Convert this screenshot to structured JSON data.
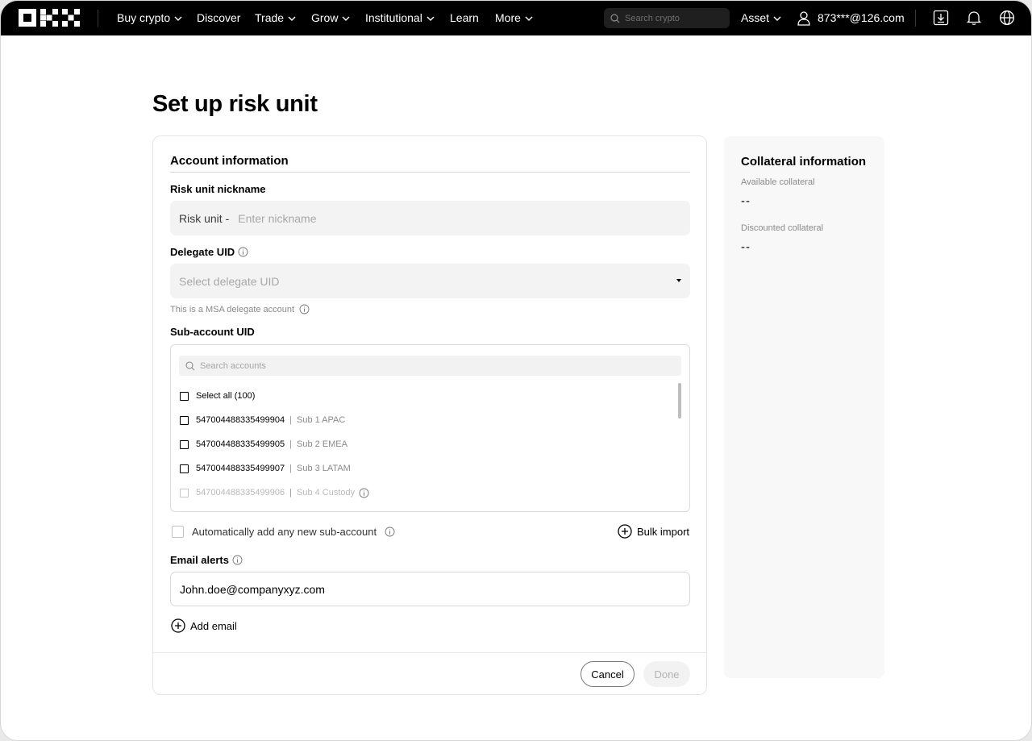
{
  "nav": {
    "items": [
      {
        "label": "Buy crypto",
        "dropdown": true
      },
      {
        "label": "Discover",
        "dropdown": false
      },
      {
        "label": "Trade",
        "dropdown": true
      },
      {
        "label": "Grow",
        "dropdown": true
      },
      {
        "label": "Institutional",
        "dropdown": true
      },
      {
        "label": "Learn",
        "dropdown": false
      },
      {
        "label": "More",
        "dropdown": true
      }
    ],
    "search_placeholder": "Search crypto",
    "asset_label": "Asset",
    "user_email": "873***@126.com",
    "icons": [
      "download-icon",
      "bell-icon",
      "globe-icon"
    ]
  },
  "page": {
    "title": "Set up risk unit"
  },
  "account": {
    "section_title": "Account information",
    "nickname_label": "Risk unit nickname",
    "nickname_prefix": "Risk unit -",
    "nickname_placeholder": "Enter nickname",
    "delegate_label": "Delegate UID",
    "delegate_placeholder": "Select delegate UID",
    "delegate_hint": "This is a MSA delegate account",
    "subaccount_label": "Sub-account UID",
    "search_accounts_placeholder": "Search accounts",
    "select_all_label": "Select all (100)",
    "subaccounts": [
      {
        "uid": "547004488335499904",
        "name": "Sub 1 APAC",
        "disabled": false,
        "info": false
      },
      {
        "uid": "547004488335499905",
        "name": "Sub 2 EMEA",
        "disabled": false,
        "info": false
      },
      {
        "uid": "547004488335499907",
        "name": "Sub 3 LATAM",
        "disabled": false,
        "info": false
      },
      {
        "uid": "547004488335499906",
        "name": "Sub 4 Custody",
        "disabled": true,
        "info": true
      }
    ],
    "auto_add_label": "Automatically add any new sub-account",
    "bulk_import_label": "Bulk import",
    "email_alerts_label": "Email alerts",
    "email_value": "John.doe@companyxyz.com",
    "add_email_label": "Add email",
    "cancel_label": "Cancel",
    "done_label": "Done"
  },
  "collateral": {
    "title": "Collateral information",
    "available_label": "Available collateral",
    "available_value": "--",
    "discounted_label": "Discounted collateral",
    "discounted_value": "--"
  }
}
